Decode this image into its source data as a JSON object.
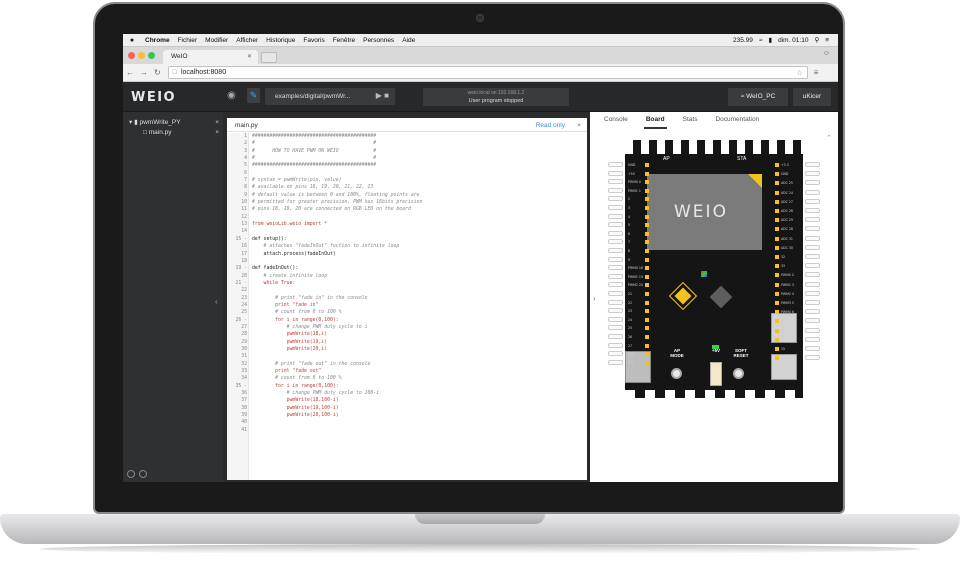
{
  "menubar": {
    "app": "Chrome",
    "items": [
      "Fichier",
      "Modifier",
      "Afficher",
      "Historique",
      "Favoris",
      "Fenêtre",
      "Personnes",
      "Aide"
    ],
    "battery_value": "235.99",
    "datetime": "dim. 01:10"
  },
  "browser": {
    "tab_title": "WeIO",
    "url": "localhost:8080"
  },
  "app": {
    "logo": "WEIO",
    "file_path": "examples/digital/pwmWr...",
    "status_line1": "weio.local on 192.168.1.2",
    "status_line2": "User program stopped",
    "wifi_label": "WeIO_PC",
    "user_label": "uKicer"
  },
  "sidebar": {
    "project": "pwmWrite_PY",
    "file": "main.py"
  },
  "editor": {
    "filename": "main.py",
    "readonly": "Read only",
    "lines": [
      {
        "n": "1",
        "t": "###########################################",
        "c": "c"
      },
      {
        "n": "2",
        "t": "#                                         #",
        "c": "c"
      },
      {
        "n": "3",
        "t": "#      HOW TO HAVE PWM ON WEIO            #",
        "c": "c"
      },
      {
        "n": "4",
        "t": "#                                         #",
        "c": "c"
      },
      {
        "n": "5",
        "t": "###########################################",
        "c": "c"
      },
      {
        "n": "6",
        "t": "",
        "c": "f"
      },
      {
        "n": "7",
        "t": "# syntax = pwmWrite(pin, value)",
        "c": "c"
      },
      {
        "n": "8",
        "t": "# available on pins 18, 19, 20, 21, 22, 23",
        "c": "c"
      },
      {
        "n": "9",
        "t": "# default value is between 0 and 100%, floating points are",
        "c": "c"
      },
      {
        "n": "10",
        "t": "# permitted for greater precision, PWM has 16bits precision",
        "c": "c"
      },
      {
        "n": "11",
        "t": "# pins 18, 19, 20 are connected on RGB LED on the board",
        "c": "c"
      },
      {
        "n": "12",
        "t": "",
        "c": "f"
      },
      {
        "n": "13",
        "t": "from weioLib.weio import *",
        "c": "k"
      },
      {
        "n": "14",
        "t": "",
        "c": "f"
      },
      {
        "n": "15 -",
        "t": "def setup():",
        "c": "f"
      },
      {
        "n": "16",
        "t": "    # attaches \"fadeInOut\" fuction to infinite loop",
        "c": "c"
      },
      {
        "n": "17",
        "t": "    attach.process(fadeInOut)",
        "c": "f"
      },
      {
        "n": "18",
        "t": "",
        "c": "f"
      },
      {
        "n": "19 -",
        "t": "def fadeInOut():",
        "c": "f"
      },
      {
        "n": "20",
        "t": "    # create infinite loop",
        "c": "c"
      },
      {
        "n": "21 -",
        "t": "    while True:",
        "c": "k"
      },
      {
        "n": "22",
        "t": "",
        "c": "f"
      },
      {
        "n": "23",
        "t": "        # print \"fade in\" in the console",
        "c": "c"
      },
      {
        "n": "24",
        "t": "        print \"fade in\"",
        "c": "s"
      },
      {
        "n": "25",
        "t": "        # count from 0 to 100 %",
        "c": "c"
      },
      {
        "n": "26 -",
        "t": "        for i in range(0,100):",
        "c": "k"
      },
      {
        "n": "27",
        "t": "            # change PWM duty cycle to i",
        "c": "c"
      },
      {
        "n": "28",
        "t": "            pwmWrite(18,i)",
        "c": "s"
      },
      {
        "n": "29",
        "t": "            pwmWrite(19,i)",
        "c": "s"
      },
      {
        "n": "30",
        "t": "            pwmWrite(20,i)",
        "c": "s"
      },
      {
        "n": "31",
        "t": "",
        "c": "f"
      },
      {
        "n": "32",
        "t": "        # print \"fade out\" in the console",
        "c": "c"
      },
      {
        "n": "33",
        "t": "        print \"fade out\"",
        "c": "s"
      },
      {
        "n": "34",
        "t": "        # count from 0 to 100 %",
        "c": "c"
      },
      {
        "n": "35 -",
        "t": "        for i in range(0,100):",
        "c": "k"
      },
      {
        "n": "36",
        "t": "            # change PWM duty cycle to 100-i",
        "c": "c"
      },
      {
        "n": "37",
        "t": "            pwmWrite(18,100-i)",
        "c": "s"
      },
      {
        "n": "38",
        "t": "            pwmWrite(19,100-i)",
        "c": "s"
      },
      {
        "n": "39",
        "t": "            pwmWrite(20,100-i)",
        "c": "s"
      },
      {
        "n": "40",
        "t": "",
        "c": "f"
      },
      {
        "n": "41",
        "t": "",
        "c": "f"
      }
    ]
  },
  "right_tabs": [
    "Console",
    "Board",
    "Stats",
    "Documentation"
  ],
  "board": {
    "ap": "AP",
    "sta": "STA",
    "logo": "WEIO",
    "ap_mode": "AP MODE",
    "five_v": "+5V",
    "soft_reset": "SOFT RESET",
    "left_pins": [
      "GND",
      "+5V",
      "PWM0 0",
      "PWM1 1",
      "2",
      "3",
      "4",
      "5",
      "6",
      "7",
      "8",
      "9",
      "PWM0 18",
      "PWM1 19",
      "PWM2 20",
      "21",
      "22",
      "23",
      "24",
      "25",
      "26",
      "27",
      "SDA",
      "SCL"
    ],
    "right_pins": [
      "+3.3",
      "GND",
      "ADC 25",
      "ADC 24",
      "ADC 27",
      "ADC 26",
      "ADC 29",
      "ADC 28",
      "ADC 31",
      "ADC 30",
      "32",
      "33",
      "PWM0 2",
      "PWM1 3",
      "PWM2 4",
      "PWM3 5",
      "PWM4 6",
      "PWM5 7",
      "17",
      "16",
      "15",
      "GND"
    ]
  },
  "colors": {
    "accent": "#3aa7f2",
    "board_yellow": "#f4c21e",
    "app_bg": "#2b2b2b"
  }
}
